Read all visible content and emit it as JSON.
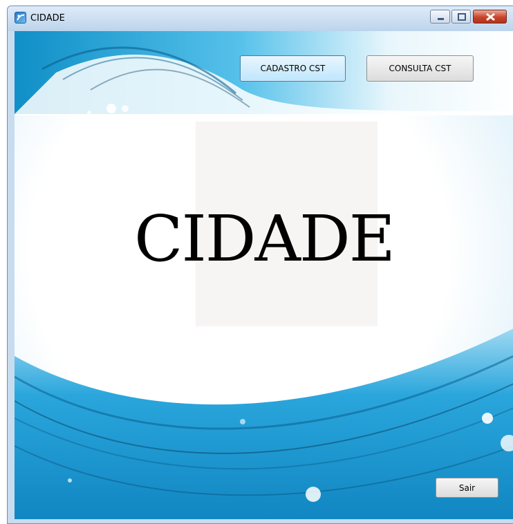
{
  "window": {
    "title": "CIDADE",
    "icon": "app-icon"
  },
  "titlebar_buttons": [
    {
      "name": "minimize-icon"
    },
    {
      "name": "maximize-icon"
    },
    {
      "name": "close-icon"
    }
  ],
  "toolbar": {
    "cadastro_label": "CADASTRO CST",
    "consulta_label": "CONSULTA CST"
  },
  "main": {
    "heading": "CIDADE"
  },
  "footer": {
    "sair_label": "Sair"
  },
  "colors": {
    "accent": "#1aa3dc",
    "deep_blue": "#0b6ea3",
    "close": "#c8442b"
  }
}
